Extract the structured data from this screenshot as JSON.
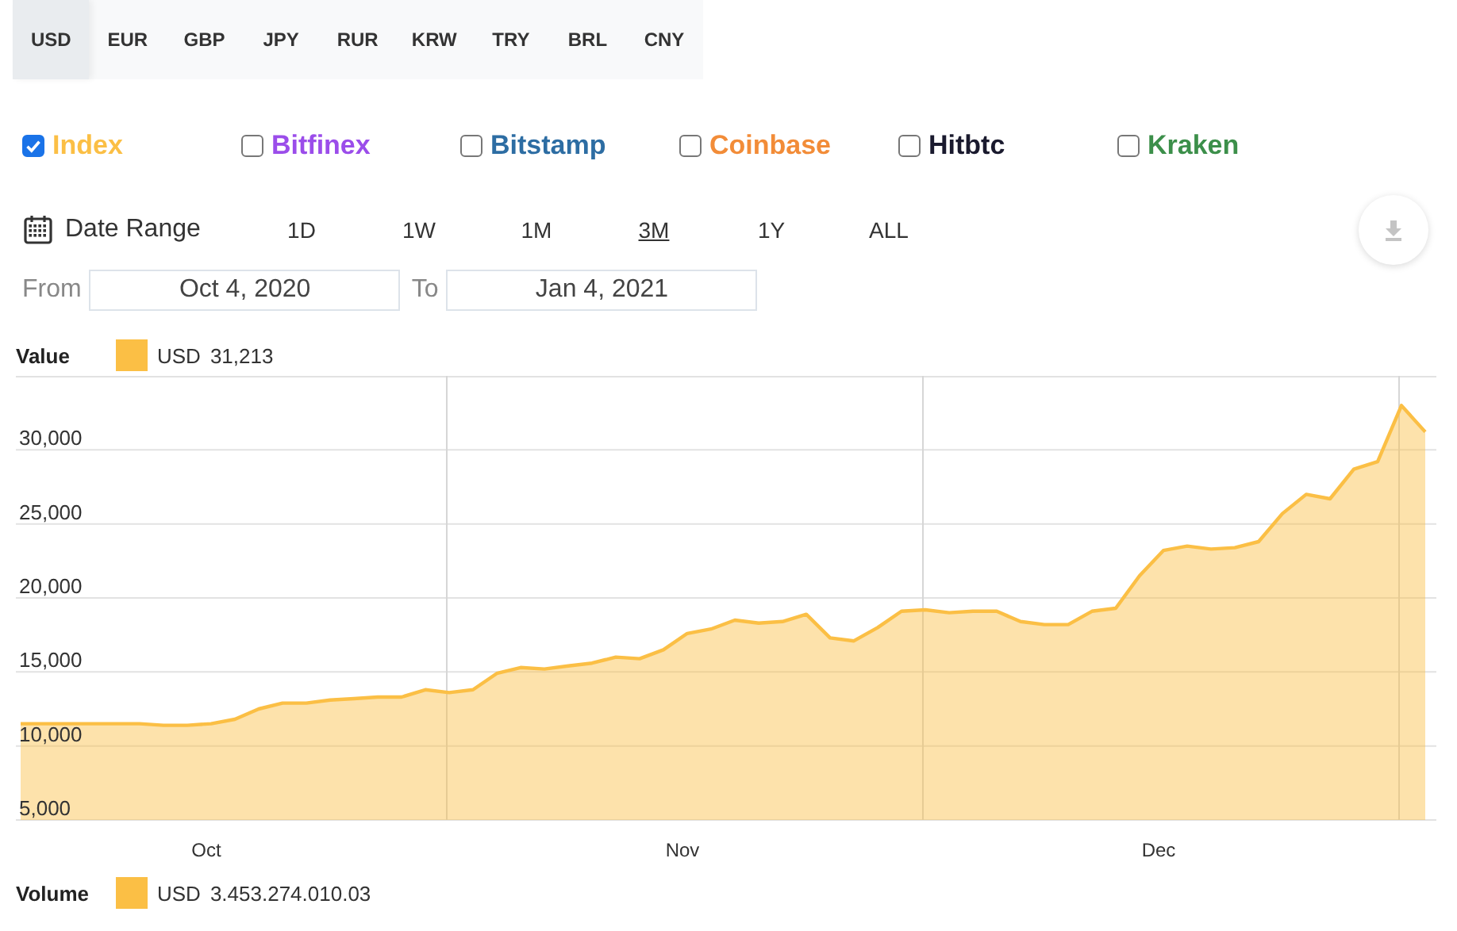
{
  "currencies": [
    {
      "label": "USD",
      "selected": true
    },
    {
      "label": "EUR",
      "selected": false
    },
    {
      "label": "GBP",
      "selected": false
    },
    {
      "label": "JPY",
      "selected": false
    },
    {
      "label": "RUR",
      "selected": false
    },
    {
      "label": "KRW",
      "selected": false
    },
    {
      "label": "TRY",
      "selected": false
    },
    {
      "label": "BRL",
      "selected": false
    },
    {
      "label": "CNY",
      "selected": false
    }
  ],
  "exchanges": [
    {
      "label": "Index",
      "checked": true,
      "color": "#fbbf45"
    },
    {
      "label": "Bitfinex",
      "checked": false,
      "color": "#9b4dea"
    },
    {
      "label": "Bitstamp",
      "checked": false,
      "color": "#2d6da3"
    },
    {
      "label": "Coinbase",
      "checked": false,
      "color": "#f28c38"
    },
    {
      "label": "Hitbtc",
      "checked": false,
      "color": "#1a1a2e"
    },
    {
      "label": "Kraken",
      "checked": false,
      "color": "#3c8f4a"
    }
  ],
  "date_range": {
    "label": "Date Range",
    "ranges": [
      {
        "label": "1D",
        "selected": false
      },
      {
        "label": "1W",
        "selected": false
      },
      {
        "label": "1M",
        "selected": false
      },
      {
        "label": "3M",
        "selected": true
      },
      {
        "label": "1Y",
        "selected": false
      },
      {
        "label": "ALL",
        "selected": false
      }
    ]
  },
  "from": {
    "label": "From",
    "value": "Oct 4, 2020"
  },
  "to": {
    "label": "To",
    "value": "Jan 4, 2021"
  },
  "value_legend": {
    "title": "Value",
    "value": "31,213"
  },
  "chart": {
    "x_axis_labels": [
      "Oct",
      "Nov",
      "Dec"
    ],
    "chart_data": {
      "type": "area",
      "grid": true,
      "ylim": [
        5000,
        35000
      ],
      "yticks": [
        {
          "value": 5000,
          "label": "5,000"
        },
        {
          "value": 10000,
          "label": "10,000"
        },
        {
          "value": 15000,
          "label": "15,000"
        },
        {
          "value": 20000,
          "label": "20,000"
        },
        {
          "value": 25000,
          "label": "25,000"
        },
        {
          "value": 30000,
          "label": "30,000"
        }
      ],
      "series": [
        {
          "name": "USD",
          "color": "#fbbf45",
          "values": [
            11500,
            11500,
            11500,
            11500,
            11500,
            11500,
            11400,
            11400,
            11500,
            11800,
            12500,
            12900,
            12900,
            13100,
            13200,
            13300,
            13300,
            13800,
            13600,
            13800,
            14900,
            15300,
            15200,
            15400,
            15600,
            16000,
            15900,
            16500,
            17600,
            17900,
            18500,
            18300,
            18400,
            18900,
            17300,
            17100,
            18000,
            19100,
            19200,
            19000,
            19100,
            19100,
            18400,
            18200,
            18200,
            19100,
            19300,
            21500,
            23200,
            23500,
            23300,
            23400,
            23800,
            25700,
            27000,
            26700,
            28700,
            29200,
            33000,
            31213
          ]
        }
      ]
    }
  },
  "volume_legend": {
    "title": "Volume",
    "series": "USD",
    "value": "3.453.274.010.03"
  }
}
